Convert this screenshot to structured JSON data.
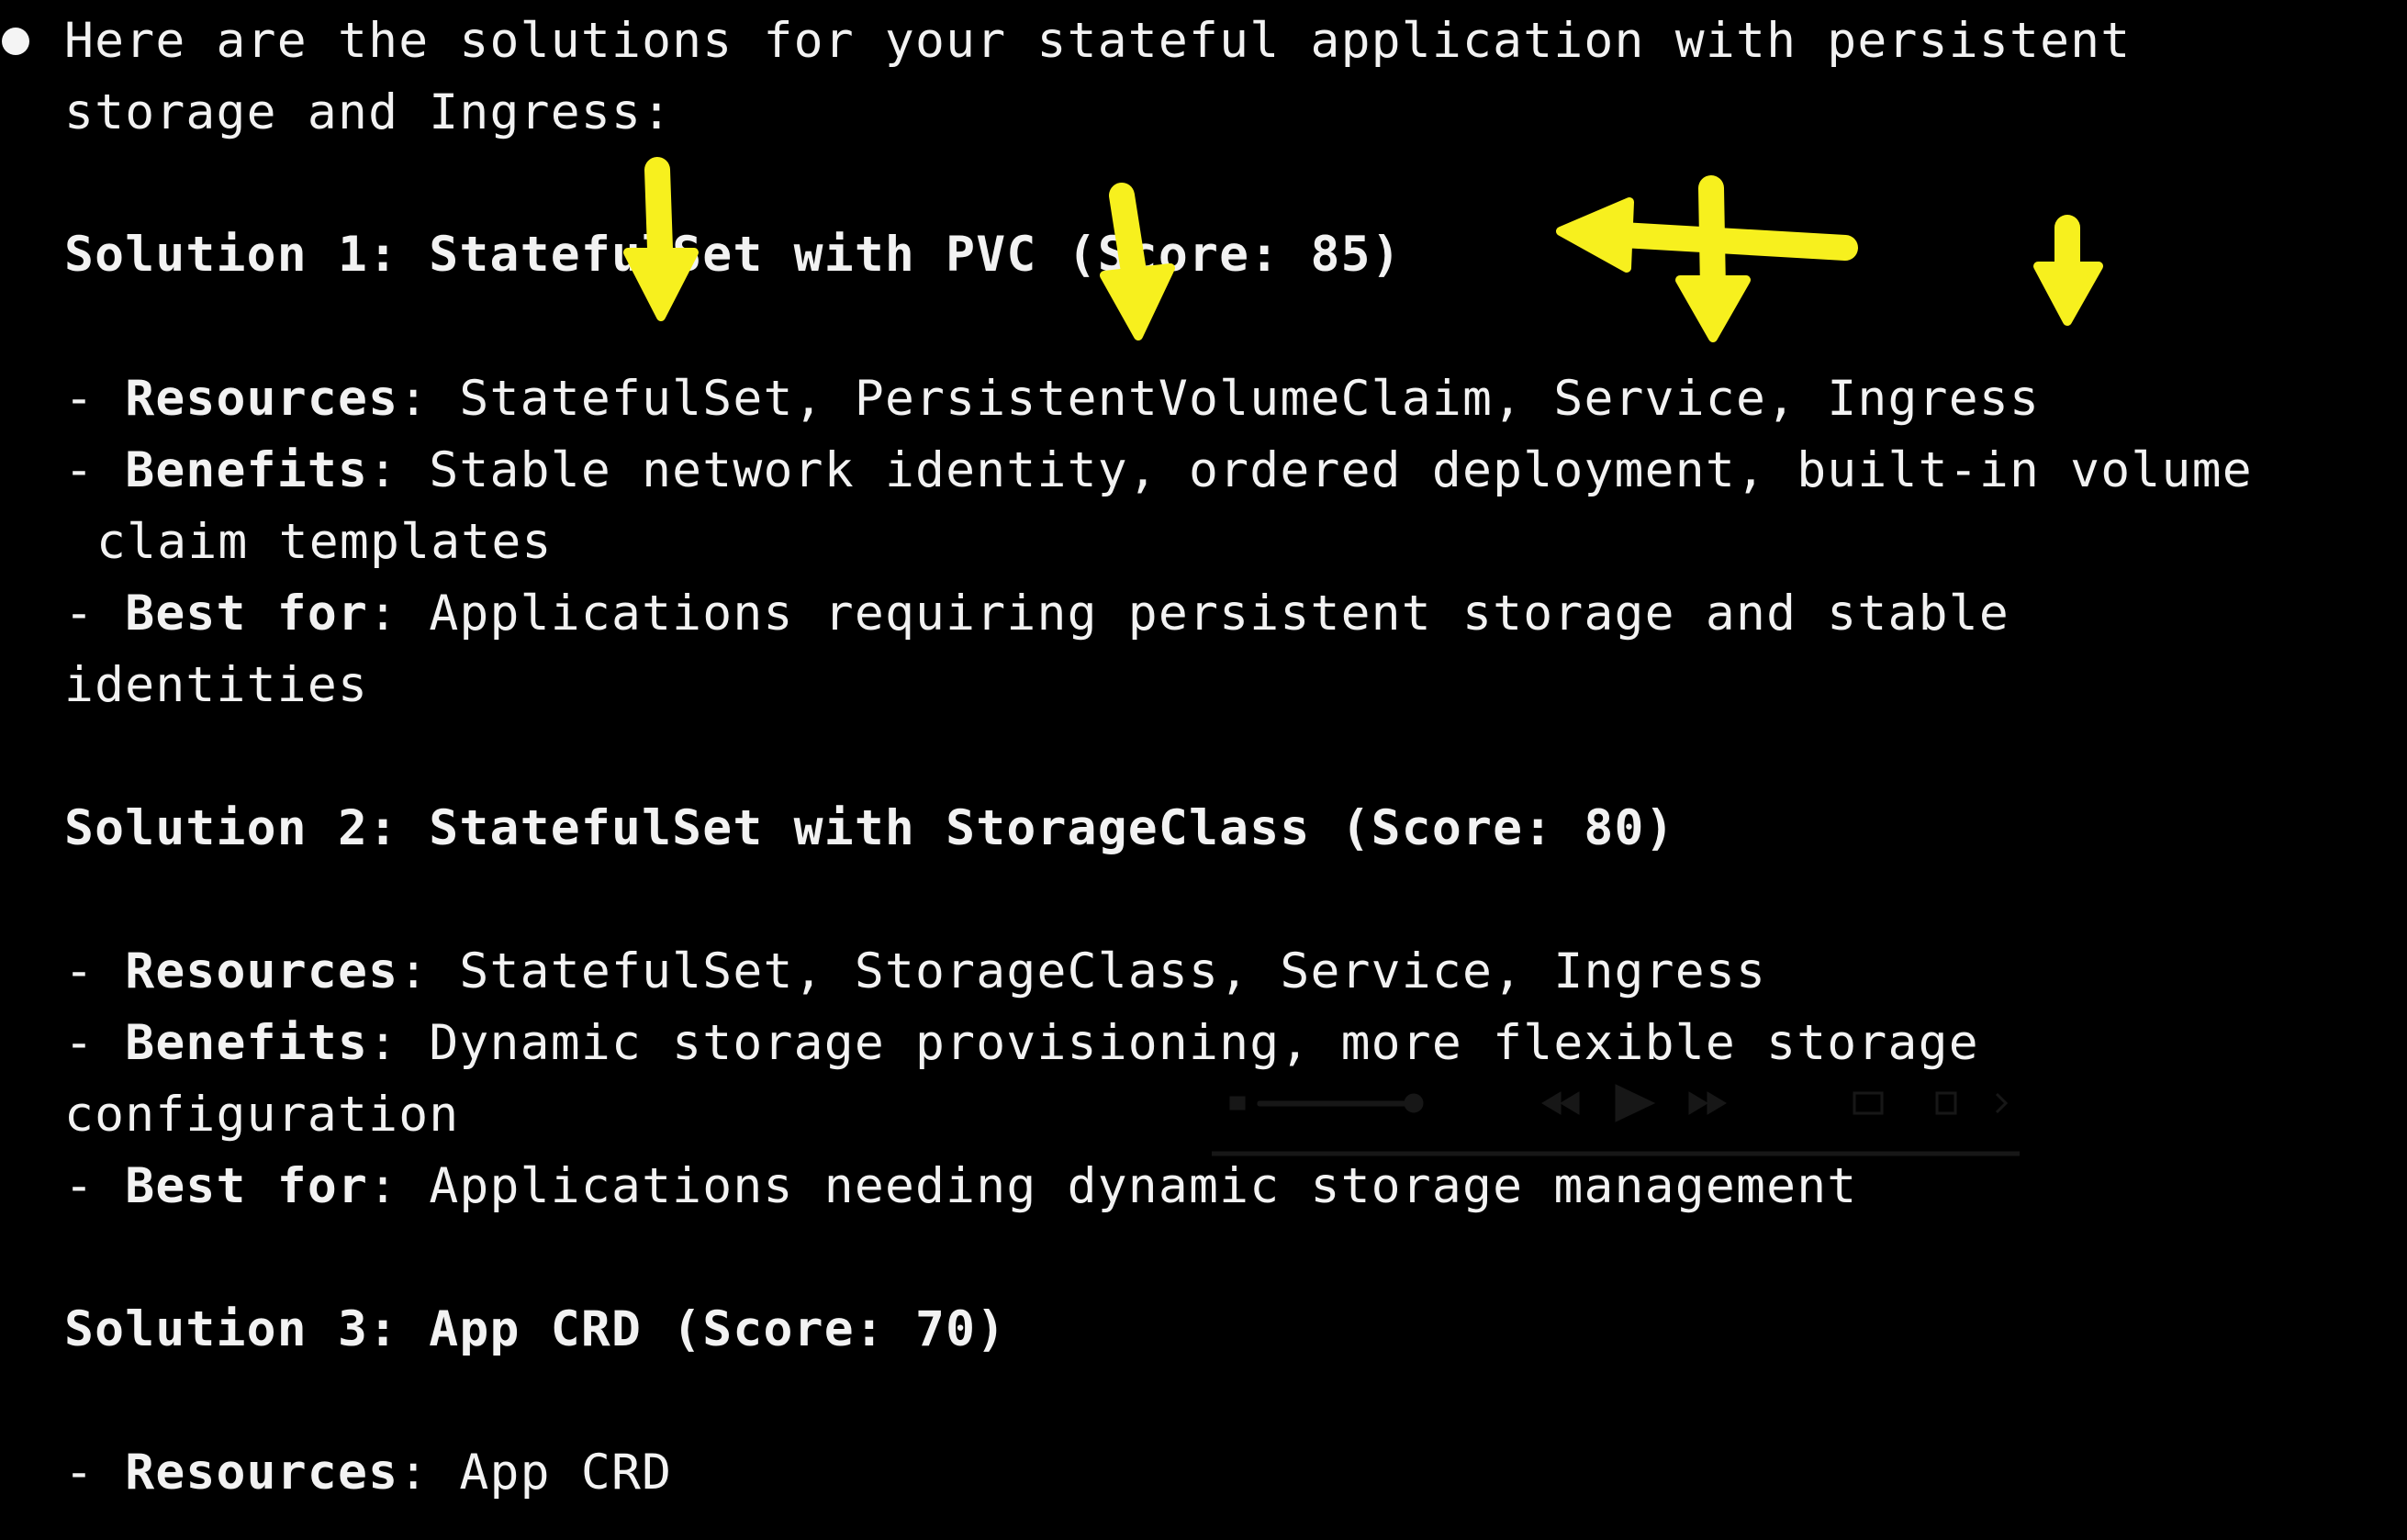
{
  "intro": {
    "line1": "Here are the solutions for your stateful application with persistent",
    "line2": "storage and Ingress:"
  },
  "solutions": [
    {
      "heading": "Solution 1: StatefulSet with PVC (Score: 85)",
      "resources_label": "Resources",
      "resources_value": "StatefulSet, PersistentVolumeClaim, Service, Ingress",
      "benefits_label": "Benefits",
      "benefits_value_line1": "Stable network identity, ordered deployment, built-in volume",
      "benefits_value_line2": "claim templates",
      "best_for_label": "Best for",
      "best_for_value_line1": "Applications requiring persistent storage and stable",
      "best_for_value_line2": "identities"
    },
    {
      "heading": "Solution 2: StatefulSet with StorageClass (Score: 80)",
      "resources_label": "Resources",
      "resources_value": "StatefulSet, StorageClass, Service, Ingress",
      "benefits_label": "Benefits",
      "benefits_value_line1": "Dynamic storage provisioning, more flexible storage",
      "benefits_value_line2": "configuration",
      "best_for_label": "Best for",
      "best_for_value_line1": "Applications needing dynamic storage management"
    },
    {
      "heading": "Solution 3: App CRD (Score: 70)",
      "resources_label": "Resources",
      "resources_value": "App CRD"
    }
  ],
  "symbols": {
    "dash": "- ",
    "colon": ": "
  },
  "colors": {
    "background": "#000000",
    "text": "#f2f2f2",
    "annotation_arrow": "#f7f01e"
  },
  "icons": {
    "bullet": "bullet-dot-icon",
    "annotation": "arrow-annotation-icon"
  }
}
